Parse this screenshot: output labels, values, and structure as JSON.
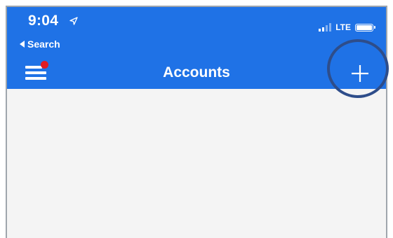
{
  "status_bar": {
    "time": "9:04",
    "back_label": "Search",
    "network": "LTE",
    "icons": [
      "location-arrow-icon",
      "signal-icon",
      "battery-icon"
    ]
  },
  "nav": {
    "title": "Accounts",
    "menu_icon": "hamburger-menu-icon",
    "add_icon": "plus-icon"
  },
  "colors": {
    "header": "#1f72e6",
    "badge": "#e11b22",
    "highlight_ring": "#2e4d8a",
    "content_bg": "#f4f4f4"
  }
}
